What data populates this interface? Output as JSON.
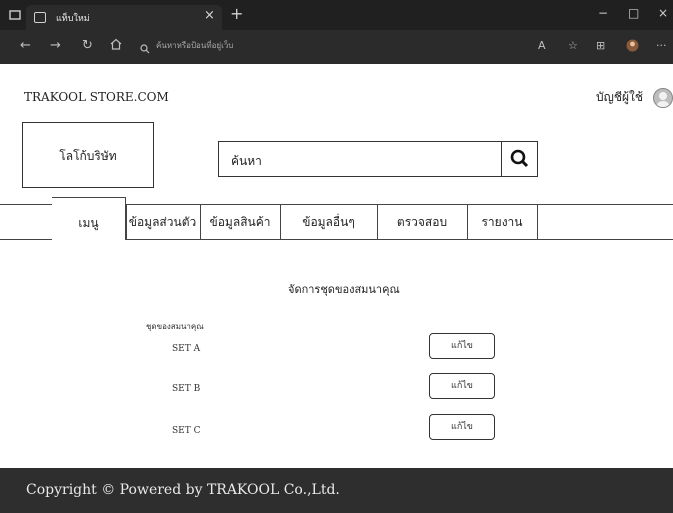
{
  "browser": {
    "tab_title": "แท็บใหม่",
    "tab_close": "×",
    "new_tab": "+",
    "window_controls": [
      "−",
      "□",
      "×"
    ],
    "address_placeholder": "ค้นหาหรือป้อนที่อยู่เว็บ"
  },
  "header": {
    "site_name": "TRAKOOL STORE.COM",
    "account_label": "บัญชีผู้ใช้"
  },
  "logo": {
    "text": "โลโก้บริษัท"
  },
  "search": {
    "placeholder": "ค้นหา"
  },
  "nav": {
    "items": [
      {
        "label": "เมนู"
      },
      {
        "label": "ข้อมูลส่วนตัว"
      },
      {
        "label": "ข้อมูลสินค้า"
      },
      {
        "label": "ข้อมูลอื่นๆ"
      },
      {
        "label": "ตรวจสอบ"
      },
      {
        "label": "รายงาน"
      }
    ]
  },
  "main": {
    "title": "จัดการชุดของสมนาคุณ",
    "sets_label": "ชุดของสมนาคุณ",
    "sets": [
      {
        "name": "SET A",
        "action": "แก้ไข"
      },
      {
        "name": "SET B",
        "action": "แก้ไข"
      },
      {
        "name": "SET C",
        "action": "แก้ไข"
      }
    ]
  },
  "footer": {
    "text": "Copyright © Powered by TRAKOOL Co.,Ltd."
  },
  "colors": {
    "chrome_dark": "#202020",
    "chrome_bar": "#2b2b2b",
    "footer_bg": "#2e2e2e",
    "border": "#333333"
  }
}
